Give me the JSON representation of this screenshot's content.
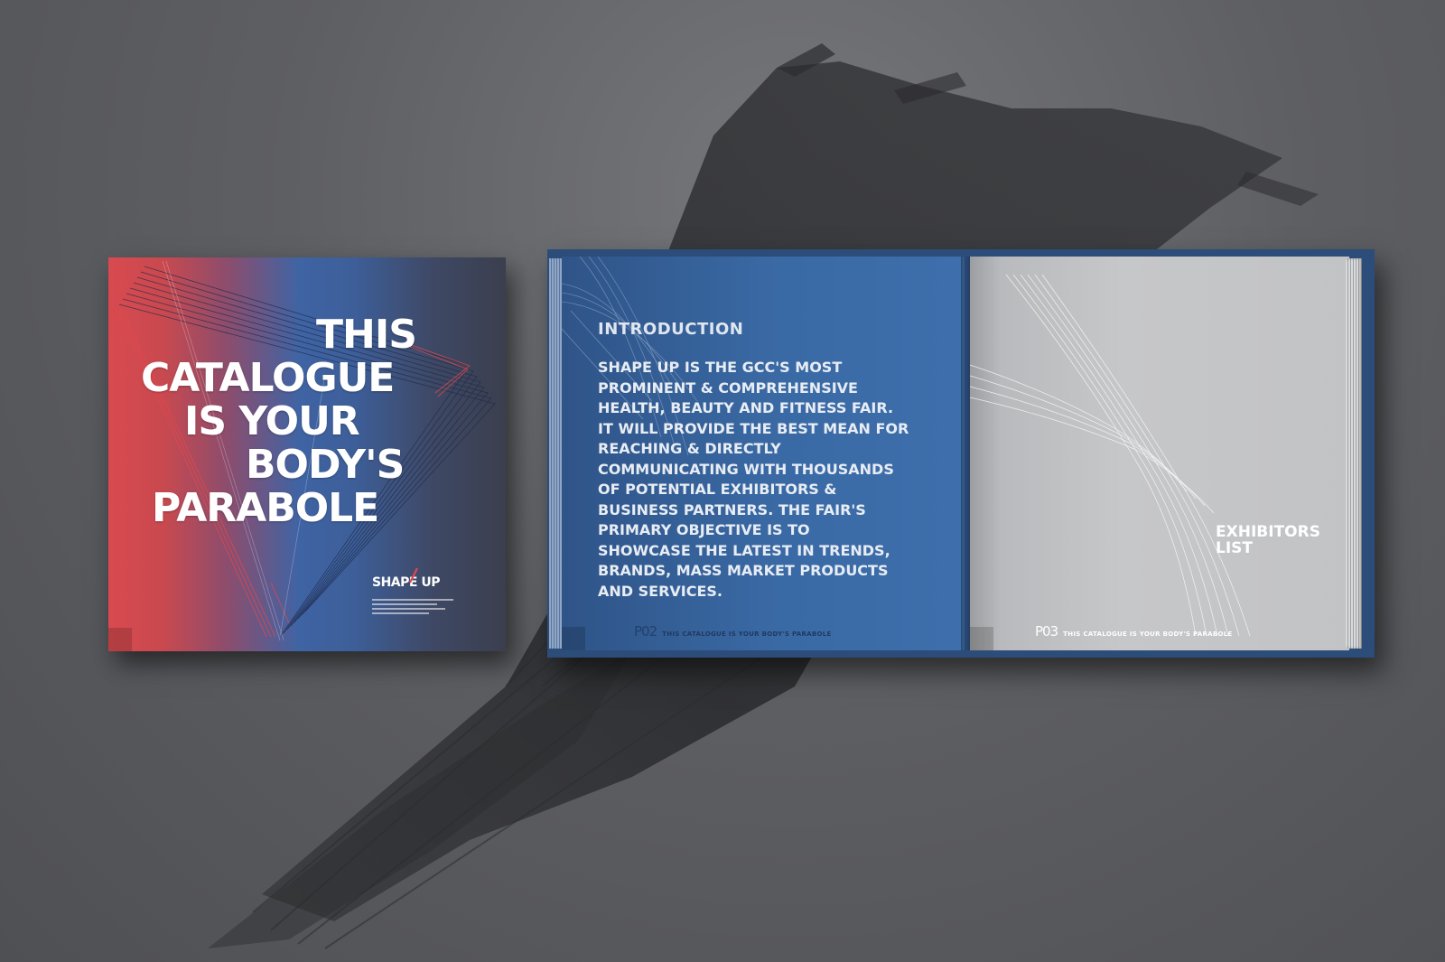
{
  "cover": {
    "title_lines": [
      "THIS",
      "CATALOGUE",
      "IS YOUR",
      "BODY'S",
      "PARABOLE"
    ],
    "logo": {
      "name": "SHAPE UP",
      "fine_print": "illegible small logo caption text"
    },
    "colors": {
      "red": "#d84a4f",
      "blue": "#3f64a4",
      "dark": "#3b3f4e"
    }
  },
  "spread": {
    "left_page": {
      "heading": "INTRODUCTION",
      "body_lines": [
        "SHAPE UP IS THE GCC'S MOST",
        "PROMINENT & COMPREHENSIVE",
        "HEALTH, BEAUTY AND FITNESS FAIR.",
        "IT WILL PROVIDE THE BEST MEAN FOR",
        "REACHING & DIRECTLY",
        "COMMUNICATING WITH THOUSANDS",
        "OF POTENTIAL EXHIBITORS &",
        "BUSINESS PARTNERS. THE FAIR'S",
        "PRIMARY OBJECTIVE IS TO",
        "SHOWCASE THE LATEST IN TRENDS,",
        "BRANDS, MASS MARKET PRODUCTS",
        "AND SERVICES."
      ],
      "folio_number": "P02",
      "folio_text": "THIS CATALOGUE IS YOUR BODY'S PARABOLE",
      "color": "#3a6aa5"
    },
    "right_page": {
      "title_lines": [
        "EXHIBITORS",
        "LIST"
      ],
      "folio_number": "P03",
      "folio_text": "THIS CATALOGUE IS YOUR BODY'S PARABOLE",
      "color": "#c6c7c9"
    }
  },
  "background": {
    "color": "#5e5f63",
    "brush_color": "#2f3033"
  }
}
